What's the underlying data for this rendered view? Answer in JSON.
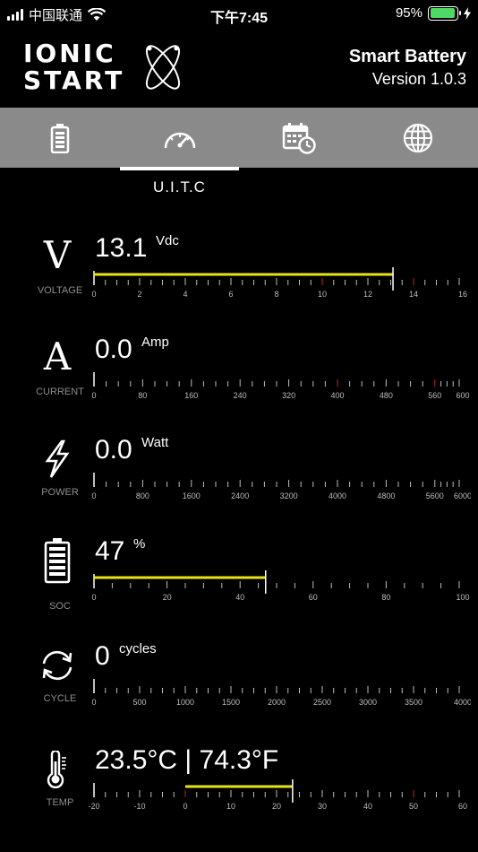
{
  "status_bar": {
    "carrier": "中国联通",
    "time": "下午7:45",
    "battery_pct": "95%",
    "battery_level": 0.95
  },
  "header": {
    "logo_line1": "IONIC",
    "logo_line2": "START",
    "title": "Smart Battery",
    "version": "Version 1.0.3"
  },
  "tabs": [
    {
      "icon": "battery-icon"
    },
    {
      "icon": "gauge-icon",
      "label": "U.I.T.C",
      "active": true
    },
    {
      "icon": "calendar-clock-icon"
    },
    {
      "icon": "globe-icon"
    }
  ],
  "colors": {
    "accent_bar": "#e8e21a",
    "red_tick": "#c0251d",
    "tabbar_bg": "#8a8a8a",
    "label_gray": "#8c8c8c"
  },
  "meters": [
    {
      "key": "voltage",
      "icon": "voltage-icon",
      "symbol": "V",
      "label": "VOLTAGE",
      "value": "13.1",
      "unit": "Vdc",
      "min": 0,
      "max": 16,
      "reading": 13.1,
      "bar_from": 0,
      "major_ticks": [
        0,
        2,
        4,
        6,
        8,
        10,
        12,
        14,
        16
      ],
      "tick_labels": [
        "0",
        "2",
        "4",
        "6",
        "8",
        "10",
        "12",
        "14",
        "16"
      ],
      "minor_per_major": 4,
      "red_ticks": [
        10,
        14
      ]
    },
    {
      "key": "current",
      "icon": "current-icon",
      "symbol": "A",
      "label": "CURRENT",
      "value": "0.0",
      "unit": "Amp",
      "min": 0,
      "max": 600,
      "reading": 0,
      "bar_from": 0,
      "major_ticks": [
        0,
        80,
        160,
        240,
        320,
        400,
        480,
        560,
        600
      ],
      "tick_labels": [
        "0",
        "80",
        "160",
        "240",
        "320",
        "400",
        "480",
        "560",
        "600"
      ],
      "minor_per_major": 4,
      "red_ticks": [
        400,
        560
      ]
    },
    {
      "key": "power",
      "icon": "lightning-icon",
      "label": "POWER",
      "value": "0.0",
      "unit": "Watt",
      "min": 0,
      "max": 6000,
      "reading": 0,
      "bar_from": 0,
      "major_ticks": [
        0,
        800,
        1600,
        2400,
        3200,
        4000,
        4800,
        5600,
        6000
      ],
      "tick_labels": [
        "0",
        "800",
        "1600",
        "2400",
        "3200",
        "4000",
        "4800",
        "5600",
        "6000"
      ],
      "minor_per_major": 4,
      "red_ticks": []
    },
    {
      "key": "soc",
      "icon": "battery-level-icon",
      "label": "SOC",
      "value": "47",
      "unit": "%",
      "min": 0,
      "max": 100,
      "reading": 47,
      "bar_from": 0,
      "major_ticks": [
        0,
        20,
        40,
        60,
        80,
        100
      ],
      "tick_labels": [
        "0",
        "20",
        "40",
        "60",
        "80",
        "100"
      ],
      "minor_per_major": 4,
      "red_ticks": []
    },
    {
      "key": "cycle",
      "icon": "cycle-icon",
      "label": "CYCLE",
      "value": "0",
      "unit": "cycles",
      "min": 0,
      "max": 4000,
      "reading": 0,
      "bar_from": 0,
      "major_ticks": [
        0,
        500,
        1000,
        1500,
        2000,
        2500,
        3000,
        3500,
        4000
      ],
      "tick_labels": [
        "0",
        "500",
        "1000",
        "1500",
        "2000",
        "2500",
        "3000",
        "3500",
        "4000"
      ],
      "minor_per_major": 4,
      "red_ticks": []
    },
    {
      "key": "temp",
      "icon": "thermometer-icon",
      "label": "TEMP",
      "value": "23.5°C | 74.3°F",
      "unit": "",
      "min": -20,
      "max": 60,
      "reading": 23.5,
      "bar_from": 0,
      "major_ticks": [
        -20,
        -10,
        0,
        10,
        20,
        30,
        40,
        50,
        60
      ],
      "tick_labels": [
        "-20",
        "-10",
        "0",
        "10",
        "20",
        "30",
        "40",
        "50",
        "60"
      ],
      "minor_per_major": 4,
      "red_ticks": [
        0,
        50
      ]
    }
  ]
}
